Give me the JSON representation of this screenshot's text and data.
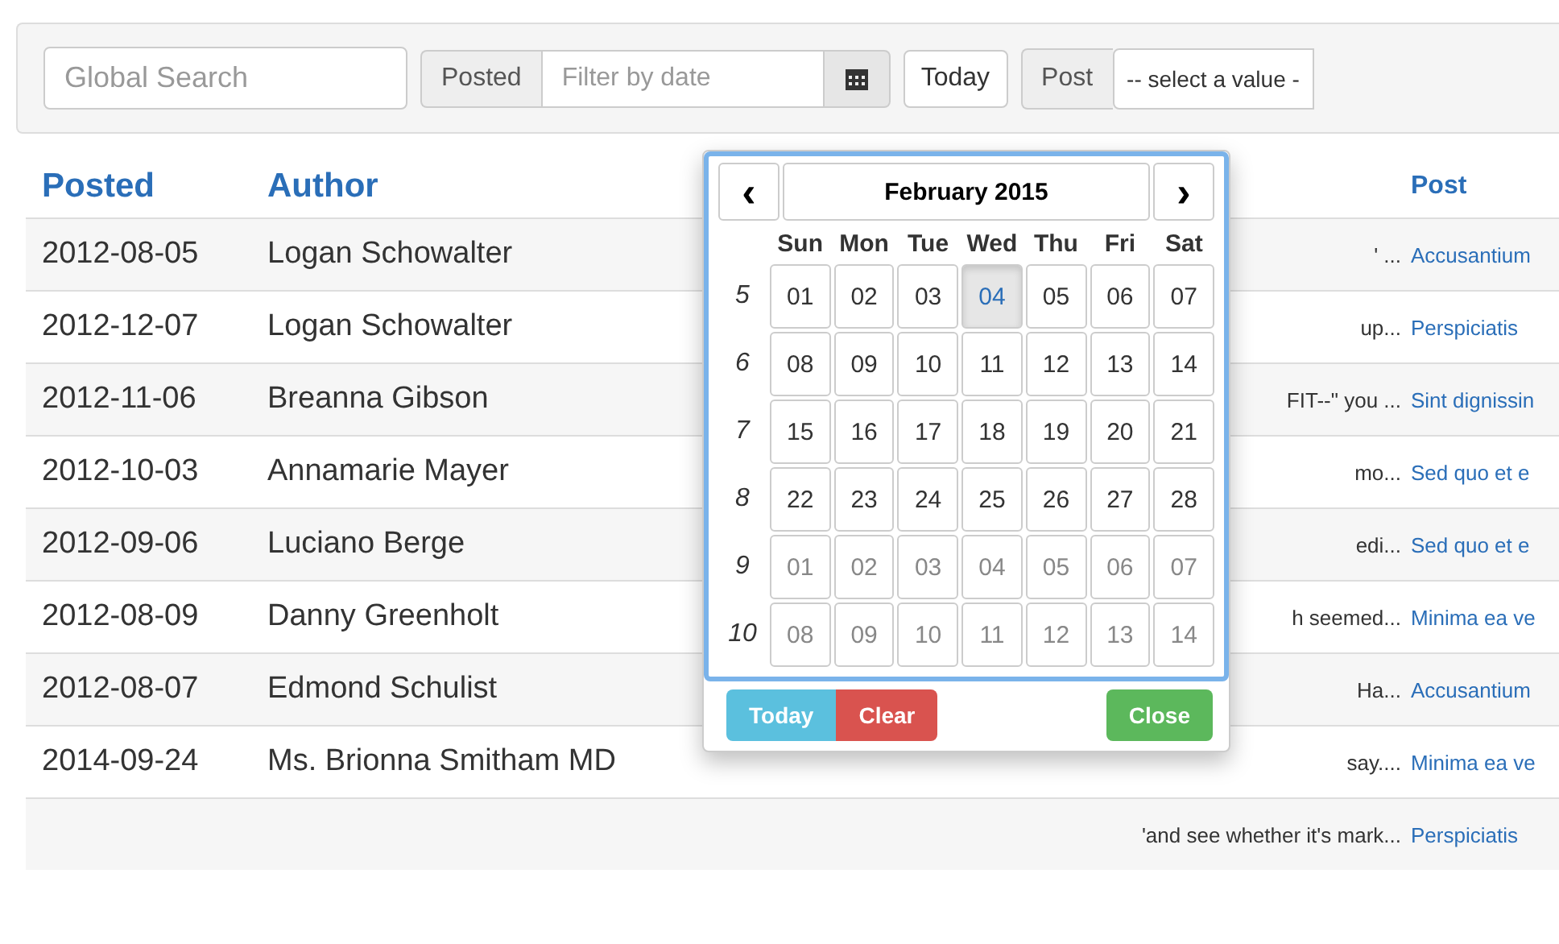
{
  "toolbar": {
    "search": {
      "placeholder": "Global Search"
    },
    "date_filter": {
      "label": "Posted",
      "placeholder": "Filter by date"
    },
    "today_button": "Today",
    "post_filter": {
      "label": "Post",
      "value": "-- select a value -"
    }
  },
  "table": {
    "columns": [
      "Posted",
      "Author",
      "Post"
    ],
    "rows": [
      {
        "posted": "2012-08-05",
        "author": "Logan Schowalter",
        "column_3": "' ...",
        "post": "Accusantium"
      },
      {
        "posted": "2012-12-07",
        "author": "Logan Schowalter",
        "column_3": "up...",
        "post": "Perspiciatis"
      },
      {
        "posted": "2012-11-06",
        "author": "Breanna Gibson",
        "column_3": "FIT--\" you ...",
        "post": "Sint dignissin"
      },
      {
        "posted": "2012-10-03",
        "author": "Annamarie Mayer",
        "column_3": "mo...",
        "post": "Sed quo et e"
      },
      {
        "posted": "2012-09-06",
        "author": "Luciano Berge",
        "column_3": "edi...",
        "post": "Sed quo et e"
      },
      {
        "posted": "2012-08-09",
        "author": "Danny Greenholt",
        "column_3": "h seemed...",
        "post": "Minima ea ve"
      },
      {
        "posted": "2012-08-07",
        "author": "Edmond Schulist",
        "column_3": "Ha...",
        "post": "Accusantium"
      },
      {
        "posted": "2014-09-24",
        "author": "Ms. Brionna Smitham MD",
        "column_3": "say....",
        "post": "Minima ea ve"
      },
      {
        "column_3": "'and see whether it's mark...",
        "post": "Perspiciatis"
      }
    ]
  },
  "datepicker": {
    "prev": "‹",
    "title": "February 2015",
    "next": "›",
    "weekdays": [
      "Sun",
      "Mon",
      "Tue",
      "Wed",
      "Thu",
      "Fri",
      "Sat"
    ],
    "weeks": [
      {
        "number": "5",
        "days": [
          {
            "day": "01",
            "muted": false,
            "selected": false
          },
          {
            "day": "02",
            "muted": false,
            "selected": false
          },
          {
            "day": "03",
            "muted": false,
            "selected": false
          },
          {
            "day": "04",
            "muted": false,
            "selected": true
          },
          {
            "day": "05",
            "muted": false,
            "selected": false
          },
          {
            "day": "06",
            "muted": false,
            "selected": false
          },
          {
            "day": "07",
            "muted": false,
            "selected": false
          }
        ]
      },
      {
        "number": "6",
        "days": [
          {
            "day": "08",
            "muted": false,
            "selected": false
          },
          {
            "day": "09",
            "muted": false,
            "selected": false
          },
          {
            "day": "10",
            "muted": false,
            "selected": false
          },
          {
            "day": "11",
            "muted": false,
            "selected": false
          },
          {
            "day": "12",
            "muted": false,
            "selected": false
          },
          {
            "day": "13",
            "muted": false,
            "selected": false
          },
          {
            "day": "14",
            "muted": false,
            "selected": false
          }
        ]
      },
      {
        "number": "7",
        "days": [
          {
            "day": "15",
            "muted": false,
            "selected": false
          },
          {
            "day": "16",
            "muted": false,
            "selected": false
          },
          {
            "day": "17",
            "muted": false,
            "selected": false
          },
          {
            "day": "18",
            "muted": false,
            "selected": false
          },
          {
            "day": "19",
            "muted": false,
            "selected": false
          },
          {
            "day": "20",
            "muted": false,
            "selected": false
          },
          {
            "day": "21",
            "muted": false,
            "selected": false
          }
        ]
      },
      {
        "number": "8",
        "days": [
          {
            "day": "22",
            "muted": false,
            "selected": false
          },
          {
            "day": "23",
            "muted": false,
            "selected": false
          },
          {
            "day": "24",
            "muted": false,
            "selected": false
          },
          {
            "day": "25",
            "muted": false,
            "selected": false
          },
          {
            "day": "26",
            "muted": false,
            "selected": false
          },
          {
            "day": "27",
            "muted": false,
            "selected": false
          },
          {
            "day": "28",
            "muted": false,
            "selected": false
          }
        ]
      },
      {
        "number": "9",
        "days": [
          {
            "day": "01",
            "muted": true,
            "selected": false
          },
          {
            "day": "02",
            "muted": true,
            "selected": false
          },
          {
            "day": "03",
            "muted": true,
            "selected": false
          },
          {
            "day": "04",
            "muted": true,
            "selected": false
          },
          {
            "day": "05",
            "muted": true,
            "selected": false
          },
          {
            "day": "06",
            "muted": true,
            "selected": false
          },
          {
            "day": "07",
            "muted": true,
            "selected": false
          }
        ]
      },
      {
        "number": "10",
        "days": [
          {
            "day": "08",
            "muted": true,
            "selected": false
          },
          {
            "day": "09",
            "muted": true,
            "selected": false
          },
          {
            "day": "10",
            "muted": true,
            "selected": false
          },
          {
            "day": "11",
            "muted": true,
            "selected": false
          },
          {
            "day": "12",
            "muted": true,
            "selected": false
          },
          {
            "day": "13",
            "muted": true,
            "selected": false
          },
          {
            "day": "14",
            "muted": true,
            "selected": false
          }
        ]
      }
    ],
    "buttons": [
      {
        "kind": "today",
        "label": "Today"
      },
      {
        "kind": "clear",
        "label": "Clear"
      },
      {
        "kind": "close",
        "label": "Close"
      }
    ]
  }
}
